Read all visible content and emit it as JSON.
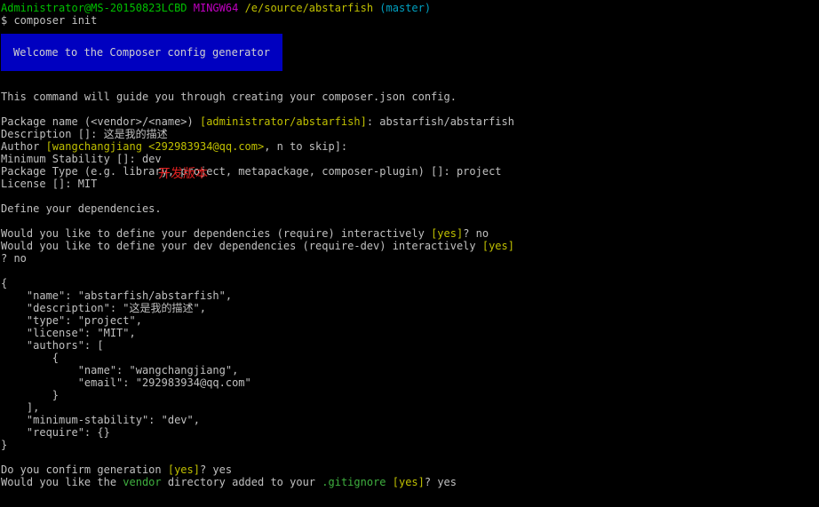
{
  "prompt": {
    "user_host": "Administrator@MS-20150823LCBD",
    "shell": "MINGW64",
    "path": "/e/source/abstarfish",
    "branch": "(master)"
  },
  "command": "$ composer init",
  "banner": "Welcome to the Composer config generator",
  "intro": "This command will guide you through creating your composer.json config.",
  "package_name": {
    "prefix": "Package name (<vendor>/<name>) ",
    "default": "[administrator/abstarfish]",
    "answer": ": abstarfish/abstarfish"
  },
  "description_line": "Description []: 这是我的描述",
  "author": {
    "prefix": "Author ",
    "default": "[wangchangjiang <292983934@qq.com>",
    "suffix": ", n to skip]:"
  },
  "min_stability_line": "Minimum Stability []: dev",
  "annotation": "开发版本",
  "package_type_line": "Package Type (e.g. library, project, metapackage, composer-plugin) []: project",
  "license_line": "License []: MIT",
  "define_deps": "Define your dependencies.",
  "deps_q": {
    "prefix": "Would you like to define your dependencies (require) interactively ",
    "default": "[yes]",
    "answer": "? no"
  },
  "dev_deps_q": {
    "prefix": "Would you like to define your dev dependencies (require-dev) interactively ",
    "default": "[yes]",
    "answer_line": "? no"
  },
  "json_lines": [
    "{",
    "    \"name\": \"abstarfish/abstarfish\",",
    "    \"description\": \"这是我的描述\",",
    "    \"type\": \"project\",",
    "    \"license\": \"MIT\",",
    "    \"authors\": [",
    "        {",
    "            \"name\": \"wangchangjiang\",",
    "            \"email\": \"292983934@qq.com\"",
    "        }",
    "    ],",
    "    \"minimum-stability\": \"dev\",",
    "    \"require\": {}",
    "}"
  ],
  "confirm_q": {
    "prefix": "Do you confirm generation ",
    "default": "[yes]",
    "answer": "? yes"
  },
  "gitignore_q": {
    "prefix": "Would you like the ",
    "vendor": "vendor",
    "middle": " directory added to your ",
    "gitignore": ".gitignore",
    "space": " ",
    "default": "[yes]",
    "answer": "? yes"
  },
  "colors": {
    "background": "#000000",
    "text": "#c0c0c0",
    "prompt_user": "#00c000",
    "prompt_shell": "#c000c0",
    "prompt_path": "#c0c000",
    "prompt_branch": "#00a0c0",
    "banner_bg": "#0000c0",
    "default_value": "#c0c000",
    "highlight": "#3fb03f",
    "annotation": "#e02020"
  }
}
